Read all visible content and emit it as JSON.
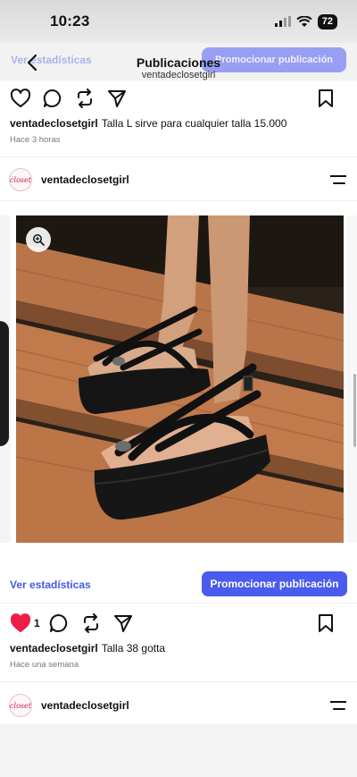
{
  "status_bar": {
    "time": "10:23",
    "battery": "72"
  },
  "header": {
    "title": "Publicaciones",
    "subtitle": "ventadeclosetgirl",
    "ghost_stats": "Ver estadísticas",
    "ghost_promote": "Promocionar publicación"
  },
  "posts": [
    {
      "user": "ventadeclosetgirl",
      "caption": "Talla L sirve para cualquier talla 15.000",
      "time": "Hace 3 horas",
      "likes": ""
    },
    {
      "user": "ventadeclosetgirl",
      "avatar_text": "closet",
      "stats_label": "Ver estadísticas",
      "promote_label": "Promocionar publicación",
      "likes": "1",
      "caption": "Talla 38 gotta",
      "time": "Hace una semana"
    },
    {
      "user": "ventadeclosetgirl",
      "avatar_text": "closet"
    }
  ],
  "colors": {
    "accent": "#4a5cf0",
    "link": "#4558e9",
    "like": "#ed1f48"
  },
  "icons": [
    "heart-icon",
    "comment-icon",
    "repost-icon",
    "share-icon",
    "bookmark-icon",
    "menu-icon",
    "zoom-icon",
    "back-icon"
  ]
}
